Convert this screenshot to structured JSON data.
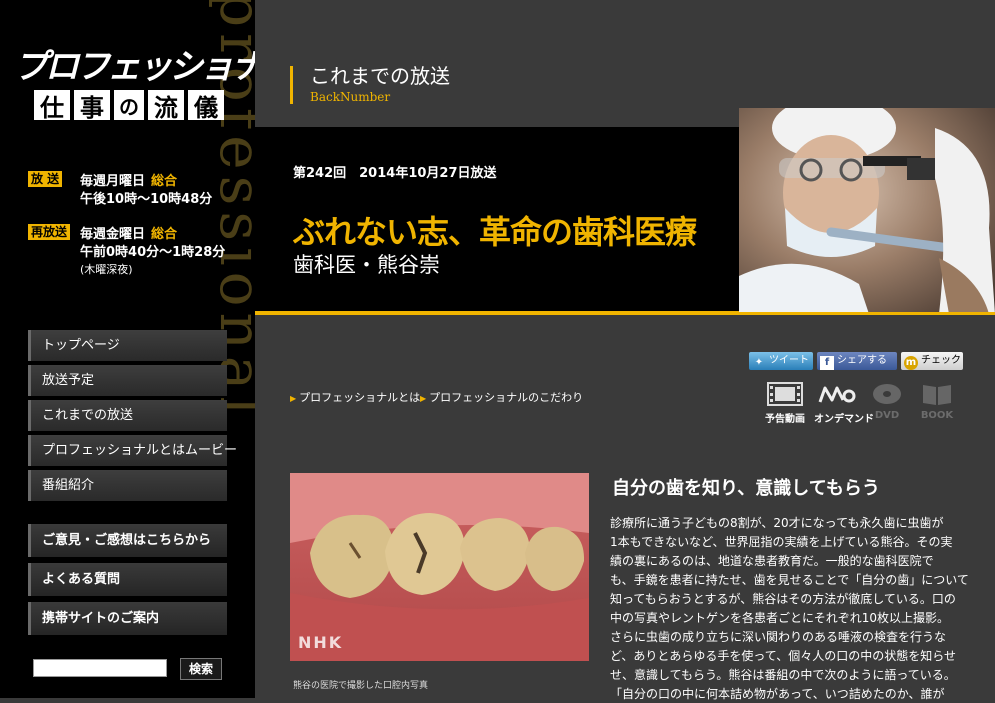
{
  "sidebar": {
    "bg_text": "professional",
    "logo_main": "プロフェッショナル",
    "logo_sub": [
      "仕",
      "事",
      "の",
      "流",
      "儀"
    ],
    "schedule": [
      {
        "tag": "放 送",
        "line1": "毎週月曜日",
        "channel": "総合",
        "line2": "午後10時～10時48分",
        "line3": ""
      },
      {
        "tag": "再放送",
        "line1": "毎週金曜日",
        "channel": "総合",
        "line2": "午前0時40分～1時28分",
        "line3": "(木曜深夜)"
      }
    ],
    "nav": [
      "トップページ",
      "放送予定",
      "これまでの放送",
      "プロフェッショナルとはムービー",
      "番組紹介"
    ],
    "nav2": [
      "ご意見・ご感想はこちらから",
      "よくある質問",
      "携帯サイトのご案内"
    ],
    "search_button": "検索"
  },
  "main": {
    "section_title": "これまでの放送",
    "section_sub": "BackNumber",
    "episode_info": "第242回　2014年10月27日放送",
    "episode_title": "ぶれない志、革命の歯科医療",
    "episode_person": "歯科医・熊谷崇",
    "share": {
      "tweet": "ツイート",
      "facebook": "シェアする",
      "mixi": "チェック"
    },
    "sublinks": [
      "プロフェッショナルとは",
      "プロフェッショナルのこだわり"
    ],
    "media": [
      {
        "label": "予告動画",
        "icon": "film-icon",
        "active": true
      },
      {
        "label": "オンデマンド",
        "icon": "ondemand-icon",
        "active": true
      },
      {
        "label": "DVD",
        "icon": "dvd-icon",
        "active": false
      },
      {
        "label": "BOOK",
        "icon": "book-icon",
        "active": false
      }
    ],
    "photo_watermark": "NHK",
    "photo_caption": "熊谷の医院で撮影した口腔内写真",
    "article_heading": "自分の歯を知り、意識してもらう",
    "article_lines": [
      "診療所に通う子どもの8割が、20才になっても永久歯に虫歯が",
      "1本もできないなど、世界屈指の実績を上げている熊谷。その実",
      "績の裏にあるのは、地道な患者教育だ。一般的な歯科医院で",
      "も、手鏡を患者に持たせ、歯を見せることで「自分の歯」について",
      "知ってもらおうとするが、熊谷はその方法が徹底している。口の",
      "中の写真やレントゲンを各患者ごとにそれぞれ10枚以上撮影。",
      "さらに虫歯の成り立ちに深い関わりのある唾液の検査を行うな",
      "ど、ありとあらゆる手を使って、個々人の口の中の状態を知らせ",
      "せ、意識してもらう。熊谷は番組の中で次のように語っている。",
      "「自分の口の中に何本詰め物があって、いつ詰めたのか、誰が"
    ]
  },
  "colors": {
    "accent": "#f0b400",
    "background": "#3a3a3a",
    "sidebar": "#000000"
  }
}
